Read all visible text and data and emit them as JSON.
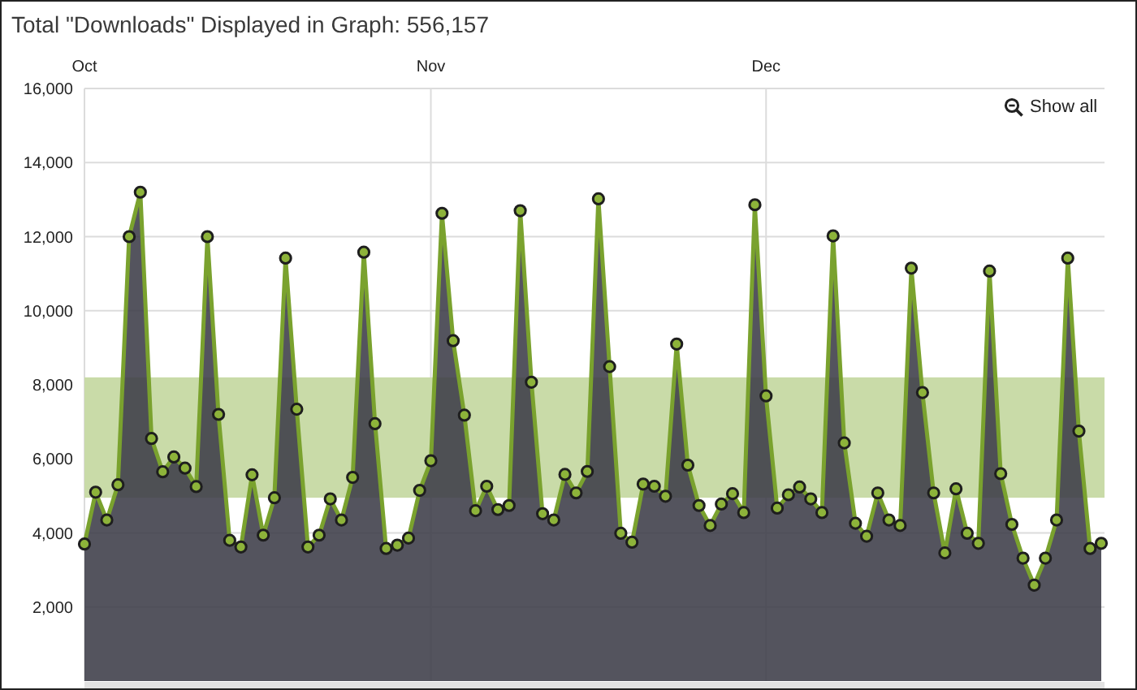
{
  "title": "Total \"Downloads\" Displayed in Graph: 556,157",
  "show_all_button": {
    "label": "Show all"
  },
  "chart_data": {
    "type": "area",
    "categories": [
      "Oct",
      null,
      null,
      null,
      null,
      null,
      null,
      null,
      null,
      null,
      null,
      null,
      null,
      null,
      null,
      null,
      null,
      null,
      null,
      null,
      null,
      null,
      null,
      null,
      null,
      null,
      null,
      null,
      null,
      null,
      null,
      "Nov",
      null,
      null,
      null,
      null,
      null,
      null,
      null,
      null,
      null,
      null,
      null,
      null,
      null,
      null,
      null,
      null,
      null,
      null,
      null,
      null,
      null,
      null,
      null,
      null,
      null,
      null,
      null,
      null,
      null,
      "Dec",
      null,
      null,
      null,
      null,
      null,
      null,
      null,
      null,
      null,
      null,
      null,
      null,
      null,
      null,
      null,
      null,
      null,
      null,
      null,
      null,
      null,
      null,
      null,
      null,
      null,
      null,
      null,
      null,
      null,
      null
    ],
    "series": [
      {
        "color": "#7aa22e",
        "values": [
          3700,
          5100,
          4350,
          5300,
          12000,
          13200,
          6550,
          5650,
          6050,
          5750,
          5250,
          12000,
          7200,
          3800,
          3620,
          5570,
          3940,
          4950,
          11420,
          7340,
          3620,
          3940,
          4920,
          4350,
          5500,
          11580,
          6950,
          3580,
          3670,
          3860,
          5150,
          5950,
          12630,
          9190,
          7180,
          4600,
          5260,
          4630,
          4740,
          12700,
          8070,
          4520,
          4350,
          5580,
          5080,
          5660,
          13020,
          8490,
          3990,
          3750,
          5320,
          5260,
          4990,
          9100,
          5830,
          4740,
          4200,
          4780,
          5060,
          4550,
          12860,
          7700,
          4670,
          5030,
          5240,
          4920,
          4550,
          12020,
          6430,
          4260,
          3910,
          5080,
          4350,
          4200,
          11150,
          7790,
          5080,
          3460,
          5190,
          3990,
          3720,
          11070,
          5600,
          4230,
          3320,
          2590,
          3320,
          4350,
          11420,
          6750,
          3580,
          3720
        ]
      }
    ],
    "ylim": [
      0,
      16000
    ],
    "yticks": [
      {
        "value": 2000,
        "label": "2,000"
      },
      {
        "value": 4000,
        "label": "4,000"
      },
      {
        "value": 6000,
        "label": "6,000"
      },
      {
        "value": 8000,
        "label": "8,000"
      },
      {
        "value": 10000,
        "label": "10,000"
      },
      {
        "value": 12000,
        "label": "12,000"
      },
      {
        "value": 14000,
        "label": "14,000"
      },
      {
        "value": 16000,
        "label": "16,000"
      }
    ],
    "grid": true,
    "bands": [
      {
        "axis": "y",
        "from": 4950,
        "to": 8200
      }
    ]
  }
}
